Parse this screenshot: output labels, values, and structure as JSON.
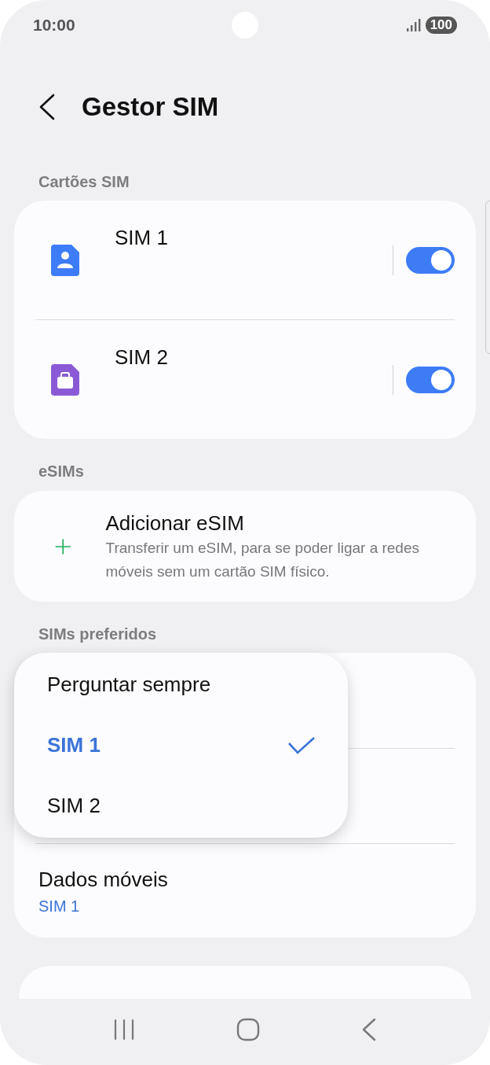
{
  "status_bar": {
    "time": "10:00",
    "battery": "100"
  },
  "header": {
    "title": "Gestor SIM"
  },
  "sim_cards": {
    "title": "Cartões SIM",
    "items": [
      {
        "name": "SIM 1",
        "on": true,
        "color": "#3d7cf6",
        "kind": "person"
      },
      {
        "name": "SIM 2",
        "on": true,
        "color": "#8a5ad6",
        "kind": "briefcase"
      }
    ]
  },
  "esims": {
    "title": "eSIMs",
    "add": {
      "title": "Adicionar eSIM",
      "description": "Transferir um eSIM, para se poder ligar a redes móveis sem um cartão SIM físico."
    }
  },
  "preferred": {
    "title": "SIMs preferidos",
    "menu": [
      {
        "label": "Perguntar sempre",
        "selected": false
      },
      {
        "label": "SIM 1",
        "selected": true
      },
      {
        "label": "SIM 2",
        "selected": false
      }
    ],
    "mobile_data": {
      "title": "Dados móveis",
      "value": "SIM 1"
    }
  }
}
